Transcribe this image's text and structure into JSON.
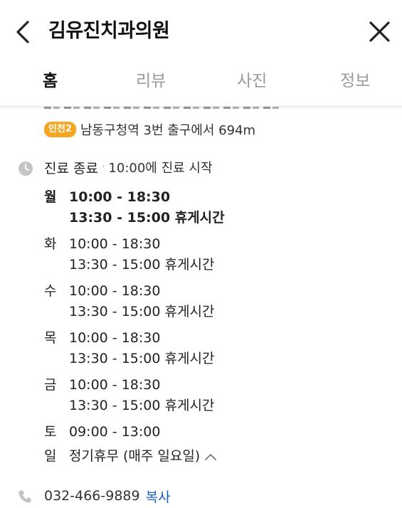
{
  "header": {
    "title": "김유진치과의원",
    "back_icon": "back-arrow-icon",
    "close_icon": "close-icon"
  },
  "tabs": [
    {
      "label": "홈",
      "active": true
    },
    {
      "label": "리뷰",
      "active": false
    },
    {
      "label": "사진",
      "active": false
    },
    {
      "label": "정보",
      "active": false
    }
  ],
  "subway": {
    "line_badge": "인천2",
    "badge_color": "#f5a623",
    "text": "남동구청역 3번 출구에서 694m"
  },
  "status": {
    "main": "진료 종료",
    "separator": "·",
    "sub": "10:00에 진료 시작"
  },
  "hours": [
    {
      "day": "월",
      "lines": [
        "10:00 - 18:30",
        "13:30 - 15:00 휴게시간"
      ],
      "today": true
    },
    {
      "day": "화",
      "lines": [
        "10:00 - 18:30",
        "13:30 - 15:00 휴게시간"
      ],
      "today": false
    },
    {
      "day": "수",
      "lines": [
        "10:00 - 18:30",
        "13:30 - 15:00 휴게시간"
      ],
      "today": false
    },
    {
      "day": "목",
      "lines": [
        "10:00 - 18:30",
        "13:30 - 15:00 휴게시간"
      ],
      "today": false
    },
    {
      "day": "금",
      "lines": [
        "10:00 - 18:30",
        "13:30 - 15:00 휴게시간"
      ],
      "today": false
    },
    {
      "day": "토",
      "lines": [
        "09:00 - 13:00"
      ],
      "today": false
    },
    {
      "day": "일",
      "lines": [
        "정기휴무 (매주 일요일)"
      ],
      "today": false
    }
  ],
  "phone": {
    "number": "032-466-9889",
    "copy_label": "복사",
    "link_color": "#1a5fc4"
  }
}
